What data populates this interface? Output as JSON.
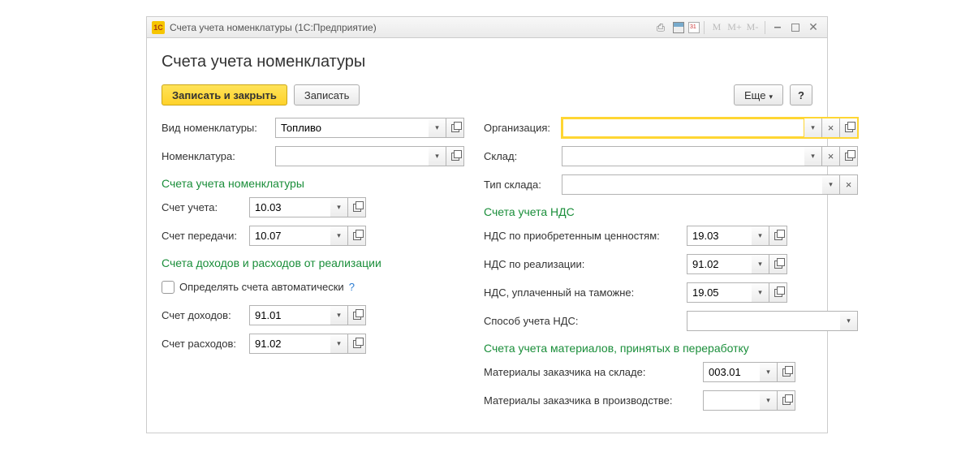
{
  "titlebar": {
    "app_logo": "1C",
    "title": "Счета учета номенклатуры  (1С:Предприятие)",
    "mem_m": "M",
    "mem_mplus": "M+",
    "mem_mminus": "M-"
  },
  "page": {
    "title": "Счета учета номенклатуры"
  },
  "toolbar": {
    "save_close": "Записать и закрыть",
    "save": "Записать",
    "more": "Еще",
    "help": "?"
  },
  "left": {
    "type_label": "Вид номенклатуры:",
    "type_value": "Топливо",
    "item_label": "Номенклатура:",
    "item_value": ""
  },
  "right": {
    "org_label": "Организация:",
    "org_value": "",
    "wh_label": "Склад:",
    "wh_value": "",
    "wh_type_label": "Тип склада:",
    "wh_type_value": ""
  },
  "sec1": {
    "title": "Счета учета номенклатуры",
    "acct_label": "Счет учета:",
    "acct_value": "10.03",
    "transfer_label": "Счет передачи:",
    "transfer_value": "10.07"
  },
  "sec2": {
    "title": "Счета учета НДС",
    "vat_in_label": "НДС по приобретенным ценностям:",
    "vat_in_value": "19.03",
    "vat_out_label": "НДС по реализации:",
    "vat_out_value": "91.02",
    "vat_customs_label": "НДС, уплаченный на таможне:",
    "vat_customs_value": "19.05",
    "vat_method_label": "Способ учета НДС:",
    "vat_method_value": ""
  },
  "sec3": {
    "title": "Счета доходов и расходов от реализации",
    "auto_label": "Определять счета автоматически",
    "income_label": "Счет доходов:",
    "income_value": "91.01",
    "expense_label": "Счет расходов:",
    "expense_value": "91.02"
  },
  "sec4": {
    "title": "Счета учета материалов, принятых в переработку",
    "mat_wh_label": "Материалы заказчика на складе:",
    "mat_wh_value": "003.01",
    "mat_prod_label": "Материалы заказчика в производстве:",
    "mat_prod_value": ""
  }
}
